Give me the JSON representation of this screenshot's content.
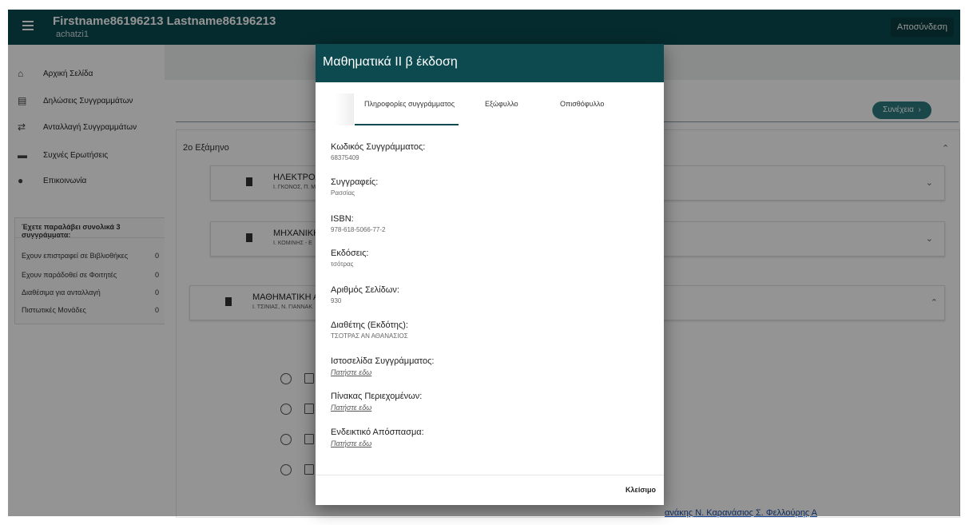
{
  "header": {
    "user_name": "Firstname86196213 Lastname86196213",
    "user_id": "achatzi1",
    "logout_label": "Αποσύνδεση"
  },
  "sidebar": {
    "items": [
      {
        "label": "Αρχική Σελίδα",
        "icon": "home-icon"
      },
      {
        "label": "Δηλώσεις Συγγραμμάτων",
        "icon": "list-icon"
      },
      {
        "label": "Ανταλλαγή Συγγραμμάτων",
        "icon": "swap-icon"
      },
      {
        "label": "Συχνές Ερωτήσεις",
        "icon": "chat-icon"
      },
      {
        "label": "Επικοινωνία",
        "icon": "help-icon"
      }
    ],
    "stats_title": "Έχετε παραλάβει συνολικά 3 συγγράμματα:",
    "stats": [
      {
        "label": "Εχουν επιστραφεί σε Βιβλιοθήκες",
        "value": "0"
      },
      {
        "label": "Εχουν παράδοθεί σε Φοιτητές",
        "value": "0"
      },
      {
        "label": "Διαθέσιμα για ανταλλαγή",
        "value": "0"
      },
      {
        "label": "Πιστωτικές Μονάδες",
        "value": "0"
      }
    ]
  },
  "main": {
    "continue_label": "Συνέχεια",
    "semester_label": "2ο Εξάμηνο",
    "books": [
      {
        "title": "ΗΛΕΚΤΡΟΛ",
        "authors": "Ι. ΓΚΟΝΟΣ, Π. Μ"
      },
      {
        "title": "ΜΗΧΑΝΙΚΗ",
        "authors": "Ι. ΚΟΜΙΝΗΣ - Ε"
      },
      {
        "title": "ΜΑΘΗΜΑΤΙΚΗ Α",
        "authors": "Ι. ΤΣΙΝΙΑΣ, Ν. ΓΙΑΝΝΑΚ"
      }
    ],
    "external_link": "ανάκης Ν. Καρανάσιος Σ. Φελλούρης Α"
  },
  "modal": {
    "title": "Μαθηματικά ΙΙ β έκδοση",
    "tabs": [
      "Πληροφορίες συγγράμματος",
      "Εξώφυλλο",
      "Οπισθόφυλλο"
    ],
    "active_tab": "Πληροφορίες συγγράμματος",
    "fields": {
      "code_label": "Κωδικός Συγγράμματος:",
      "code_value": "68375409",
      "authors_label": "Συγγραφείς:",
      "authors_value": "Ρασσίας",
      "isbn_label": "ISBN:",
      "isbn_value": "978-618-5066-77-2",
      "editions_label": "Εκδόσεις:",
      "editions_value": "τσότρας",
      "pages_label": "Αριθμός Σελίδων:",
      "pages_value": "930",
      "publisher_label": "Διαθέτης (Εκδότης):",
      "publisher_value": "ΤΣΟΤΡΑΣ ΑΝ ΑΘΑΝΑΣΙΟΣ",
      "website_label": "Ιστοσελίδα Συγγράμματος:",
      "website_link": "Πατήστε εδω",
      "toc_label": "Πίνακας Περιεχομένων:",
      "toc_link": "Πατήστε εδω",
      "excerpt_label": "Ενδεικτικό Απόσπασμα:",
      "excerpt_link": "Πατήστε εδω"
    },
    "close_label": "Κλείσιμο"
  }
}
